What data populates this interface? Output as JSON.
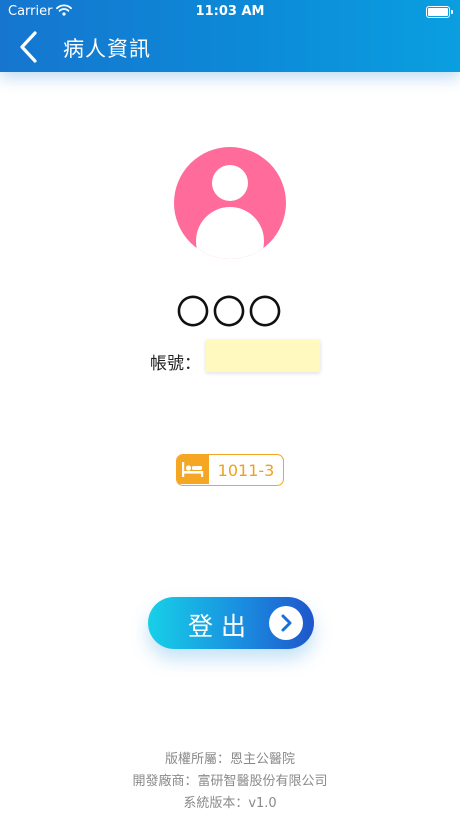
{
  "status_bar": {
    "carrier": "Carrier",
    "time": "11:03 AM"
  },
  "nav": {
    "title": "病人資訊",
    "back_icon": "chevron-left-icon"
  },
  "patient": {
    "avatar_icon": "user-avatar-icon",
    "name": "〇〇〇"
  },
  "account": {
    "label": "帳號：",
    "value": "",
    "placeholder": ""
  },
  "bed": {
    "icon": "bed-icon",
    "number": "1011-3"
  },
  "logout": {
    "label": "登出",
    "icon": "chevron-right-circle-icon"
  },
  "footer": {
    "copyright": "版權所屬：恩主公醫院",
    "developer": "開發廠商：富研智醫股份有限公司",
    "version": "系統版本：v1.0"
  },
  "colors": {
    "nav_bar": "#1676cf",
    "avatar": "#ff6c9c",
    "account_field": "#fff9bf",
    "bed_badge": "#f5a623",
    "logout_start": "#17d0e8",
    "logout_end": "#1f56cc",
    "footer_text": "#8a8a8a"
  }
}
